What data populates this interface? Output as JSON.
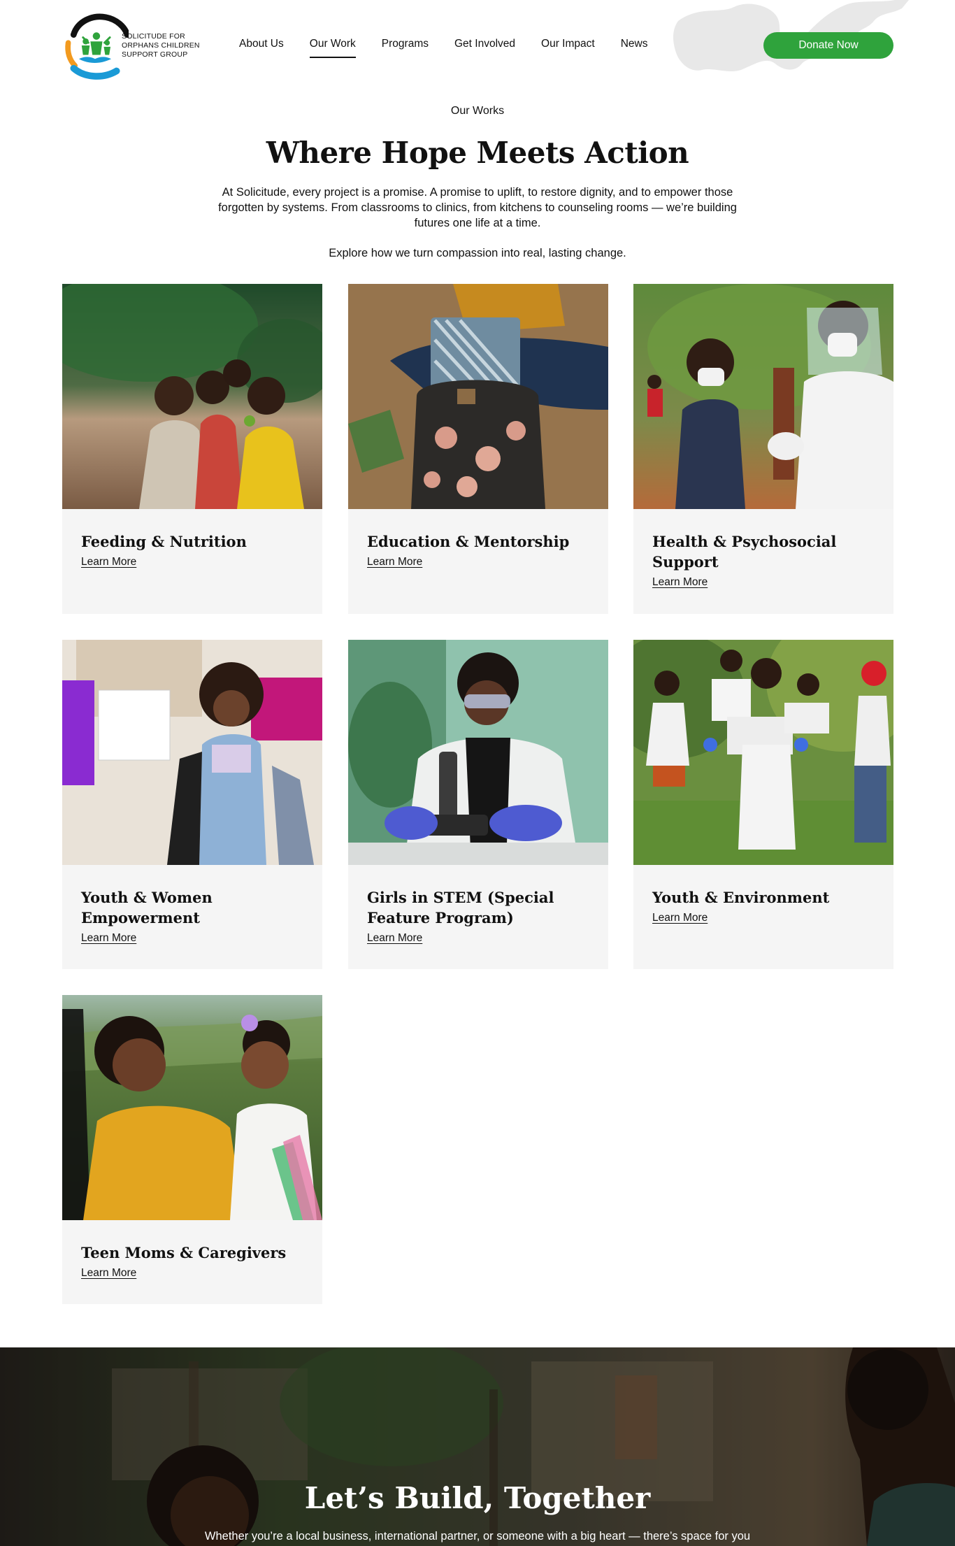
{
  "brand": {
    "name": "Solicitude for Orphans Children Support Group",
    "accent_green": "#2fa33c",
    "logo_blue": "#1a9ad6",
    "logo_orange": "#f29a1f"
  },
  "nav": {
    "items": [
      {
        "label": "About Us",
        "active": false
      },
      {
        "label": "Our Work",
        "active": true
      },
      {
        "label": "Programs",
        "active": false
      },
      {
        "label": "Get Involved",
        "active": false
      },
      {
        "label": "Our Impact",
        "active": false
      },
      {
        "label": "News",
        "active": false
      }
    ],
    "donate_label": "Donate Now"
  },
  "intro": {
    "eyebrow": "Our Works",
    "headline": "Where Hope Meets Action",
    "lede": "At Solicitude, every project is a promise. A promise to uplift, to restore dignity, and to empower those forgotten by systems. From classrooms to clinics, from kitchens to counseling rooms — we’re building futures one life at a time.",
    "lede2": "Explore how we turn compassion into real, lasting change."
  },
  "programs": [
    {
      "title": "Feeding & Nutrition",
      "link": "Learn More",
      "image": "children-eating-photo"
    },
    {
      "title": "Education & Mentorship",
      "link": "Learn More",
      "image": "school-backpack-photo"
    },
    {
      "title": "Health & Psychosocial Support",
      "link": "Learn More",
      "image": "child-vaccination-photo"
    },
    {
      "title": "Youth & Women Empowerment",
      "link": "Learn More",
      "image": "women-rally-photo"
    },
    {
      "title": "Girls in STEM (Special Feature Program)",
      "link": "Learn More",
      "image": "microscope-scientist-photo"
    },
    {
      "title": "Youth & Environment",
      "link": "Learn More",
      "image": "unity-signs-photo"
    },
    {
      "title": "Teen Moms & Caregivers",
      "link": "Learn More",
      "image": "mother-and-baby-photo"
    }
  ],
  "cta": {
    "title": "Let’s Build, Together",
    "text": "Whether you’re a local business, international partner, or someone with a big heart — there’s space for you"
  }
}
